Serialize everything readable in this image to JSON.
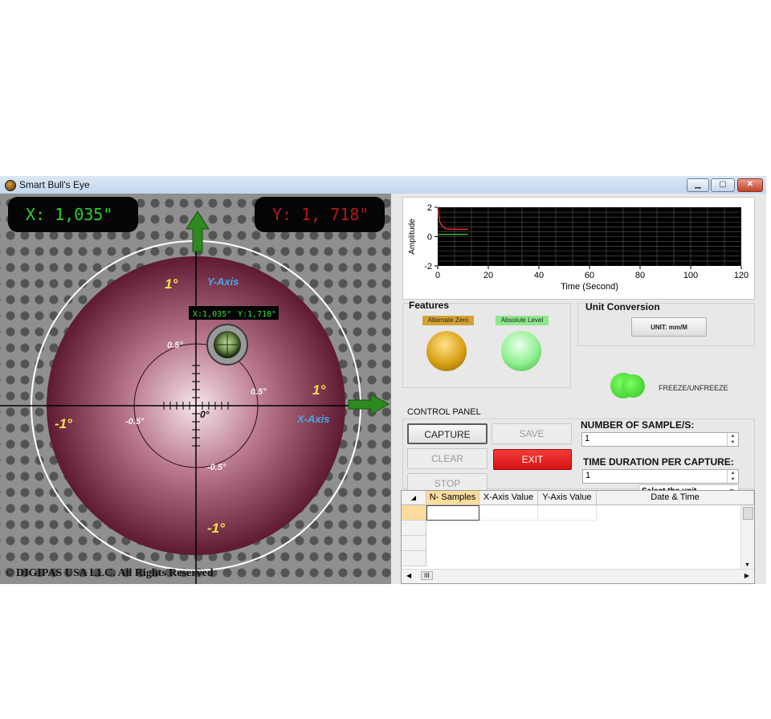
{
  "window": {
    "title": "Smart Bull's Eye"
  },
  "bullseye": {
    "readout_x": "X: 1,035\"",
    "readout_y": "Y: 1, 718\"",
    "inner_readout_x": "X:1,035\"",
    "inner_readout_y": "Y:1,718\"",
    "label_1deg_top": "1°",
    "label_1deg_right": "1°",
    "label_neg1deg_left": "-1°",
    "label_neg1deg_bottom": "-1°",
    "label_05_top": "0.5°",
    "label_05_right": "0.5°",
    "label_neg05_left": "-0.5°",
    "label_neg05_bottom": "-0.5°",
    "label_zero": "0°",
    "label_y_axis": "Y-Axis",
    "label_x_axis": "X-Axis",
    "colors": {
      "lcd_x": "#2bd12b",
      "lcd_y": "#b31818",
      "degree_labels": "#f6e34a",
      "axis_labels": "#4da6e8",
      "arrow": "#2d8a1f"
    }
  },
  "copyright": "© DIGIPAS USA LLC. All Rights Reserved",
  "chart_data": {
    "type": "line",
    "xlabel": "Time (Second)",
    "ylabel": "Amplitude",
    "x_ticks": [
      "0",
      "20",
      "40",
      "60",
      "80",
      "100",
      "120"
    ],
    "y_ticks": [
      "2",
      "0",
      "-2"
    ],
    "xlim": [
      0,
      120
    ],
    "ylim": [
      -2,
      2
    ],
    "grid": true,
    "series": [
      {
        "color": "#e03030",
        "x": [
          0,
          0.8,
          1.6,
          3,
          5,
          8,
          12
        ],
        "y": [
          2,
          1.0,
          0.75,
          0.55,
          0.5,
          0.5,
          0.5
        ]
      },
      {
        "color": "#2fc02f",
        "x": [
          0,
          3,
          6,
          9,
          12
        ],
        "y": [
          0.15,
          0.15,
          0.15,
          0.15,
          0.15
        ]
      }
    ]
  },
  "features": {
    "title": "Features",
    "alt_zero_label": "Alternate Zero",
    "abs_level_label": "Absolute Level"
  },
  "unit_conversion": {
    "title": "Unit Conversion",
    "unit_button": "UNIT: mm/M",
    "freeze_label": "FREEZE/UNFREEZE"
  },
  "control_panel": {
    "title": "CONTROL PANEL",
    "capture": "CAPTURE",
    "save": "SAVE",
    "clear": "CLEAR",
    "exit": "EXIT",
    "stop": "STOP",
    "samples_label": "NUMBER OF SAMPLE/S:",
    "samples_value": "1",
    "duration_label": "TIME DURATION PER CAPTURE:",
    "duration_value": "1",
    "unit_select": "Select the unit"
  },
  "grid": {
    "columns": [
      "N- Samples",
      "X-Axis Value",
      "Y-Axis Value",
      "Date & Time"
    ],
    "scroll_thumb": "III"
  }
}
